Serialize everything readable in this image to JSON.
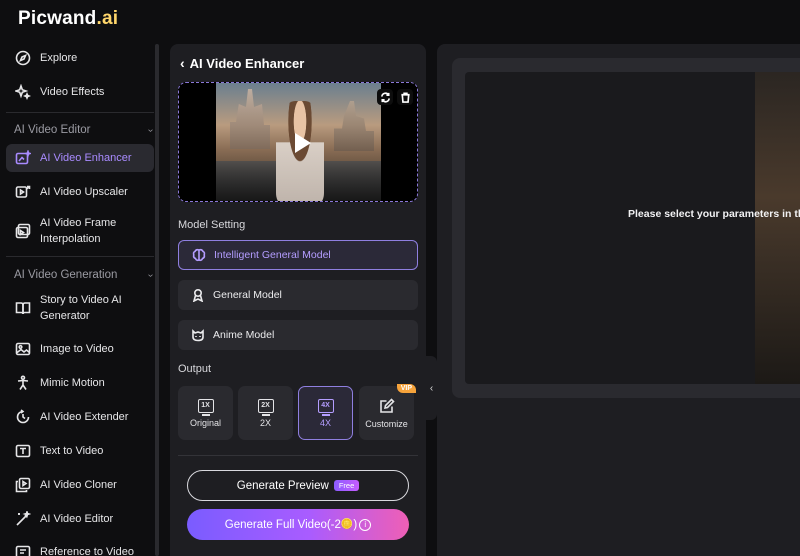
{
  "brand": {
    "name_main": "Picwand",
    "name_suffix": ".ai"
  },
  "sidebar": {
    "top_items": [
      {
        "label": "Explore",
        "icon": "compass-icon"
      },
      {
        "label": "Video Effects",
        "icon": "sparkle-icon"
      }
    ],
    "sections": [
      {
        "title": "AI Video Editor",
        "items": [
          {
            "label": "AI Video Enhancer",
            "icon": "enhance-icon",
            "active": true
          },
          {
            "label": "AI Video Upscaler",
            "icon": "upscale-icon"
          },
          {
            "label": "AI Video Frame Interpolation",
            "label_line1": "AI Video Frame",
            "label_line2": "Interpolation",
            "icon": "frame-icon"
          }
        ]
      },
      {
        "title": "AI Video Generation",
        "items": [
          {
            "label_line1": "Story to Video AI",
            "label_line2": "Generator",
            "icon": "book-icon"
          },
          {
            "label": "Image to Video",
            "icon": "image-icon"
          },
          {
            "label": "Mimic Motion",
            "icon": "motion-icon"
          },
          {
            "label": "AI Video Extender",
            "icon": "extend-icon"
          },
          {
            "label": "Text to Video",
            "icon": "text-video-icon"
          },
          {
            "label": "AI Video Cloner",
            "icon": "clone-icon"
          },
          {
            "label": "AI Video Editor",
            "icon": "wand-icon"
          },
          {
            "label": "Reference to Video",
            "icon": "reference-icon"
          }
        ]
      }
    ]
  },
  "panel": {
    "title": "AI Video Enhancer",
    "model_setting_label": "Model Setting",
    "models": [
      {
        "label": "Intelligent General Model",
        "selected": true
      },
      {
        "label": "General Model",
        "selected": false
      },
      {
        "label": "Anime Model",
        "selected": false
      }
    ],
    "output_label": "Output",
    "outputs": [
      {
        "icon_text": "1X",
        "label": "Original",
        "selected": false
      },
      {
        "icon_text": "2X",
        "label": "2X",
        "selected": false
      },
      {
        "icon_text": "4X",
        "label": "4X",
        "selected": true
      },
      {
        "label": "Customize",
        "badge": "VIP",
        "selected": false
      }
    ],
    "generate_preview": "Generate Preview",
    "free_badge": "Free",
    "generate_full": "Generate Full Video(-2",
    "generate_full_suffix": ")",
    "info_glyph": "i"
  },
  "workspace": {
    "hint": "Please select your parameters in the"
  },
  "colors": {
    "accent": "#a98bff",
    "vip": "#f6a33b",
    "gradient_start": "#7a5cff",
    "gradient_end": "#ef5fb5"
  }
}
